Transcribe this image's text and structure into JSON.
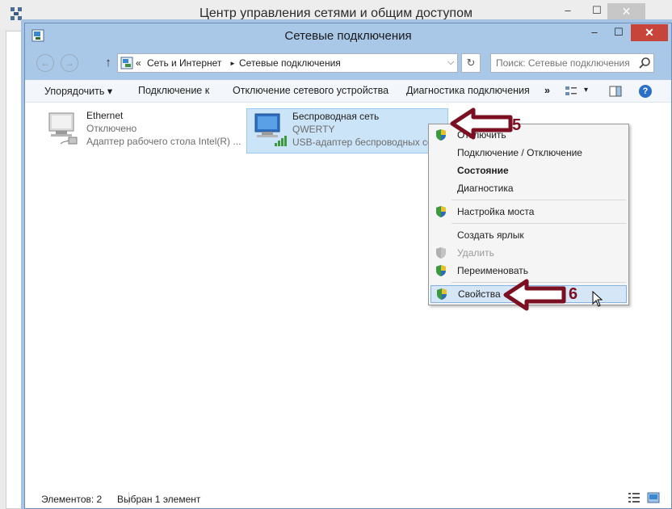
{
  "back_window": {
    "title": "Центр управления сетями и общим доступом",
    "min": "–",
    "max": "☐",
    "close": "✕"
  },
  "window": {
    "title": "Сетевые подключения",
    "min": "–",
    "max": "☐",
    "close": "✕"
  },
  "nav": {
    "back": "←",
    "forward": "→",
    "up": "↑",
    "refresh": "↻",
    "crumb_prefix": "«",
    "crumbs": [
      "Сеть и Интернет",
      "Сетевые подключения"
    ],
    "crumb_sep": "►",
    "dropdown": "⌵"
  },
  "search": {
    "placeholder": "Поиск: Сетевые подключения"
  },
  "toolbar": {
    "organize": "Упорядочить ▾",
    "connect_to": "Подключение к",
    "disable_device": "Отключение сетевого устройства",
    "diagnose": "Диагностика подключения",
    "more": "»",
    "view_dd": "▾",
    "help": "?"
  },
  "items": [
    {
      "name": "Ethernet",
      "status": "Отключено",
      "adapter": "Адаптер рабочего стола Intel(R) ..."
    },
    {
      "name": "Беспроводная сеть",
      "status": "QWERTY",
      "adapter": "USB-адаптер беспроводных сетей"
    }
  ],
  "context_menu": {
    "items": [
      {
        "label": "Отключить"
      },
      {
        "label": "Подключение / Отключение"
      },
      {
        "label": "Состояние"
      },
      {
        "label": "Диагностика"
      },
      {
        "label": "Настройка моста"
      },
      {
        "label": "Создать ярлык"
      },
      {
        "label": "Удалить"
      },
      {
        "label": "Переименовать"
      },
      {
        "label": "Свойства"
      }
    ]
  },
  "annotations": {
    "step5": "5",
    "step6": "6",
    "color": "#7a1022"
  },
  "status": {
    "count": "Элементов: 2",
    "selected": "Выбран 1 элемент"
  },
  "colors": {
    "title_bar": "#a9c7e7",
    "close_button": "#c7443a",
    "selection": "#cce4f7"
  }
}
